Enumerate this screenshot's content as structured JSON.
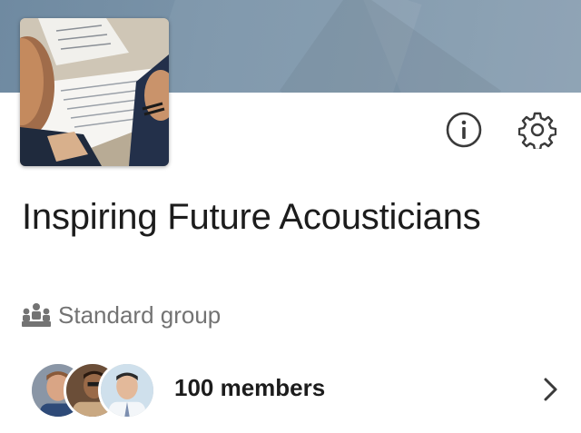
{
  "group": {
    "title": "Inspiring Future Acousticians",
    "type_label": "Standard group",
    "type_icon": "people-group-icon"
  },
  "actions": {
    "info_icon": "info-icon",
    "settings_icon": "gear-icon"
  },
  "members": {
    "label": "100 members",
    "avatars": [
      "member-avatar-1",
      "member-avatar-2",
      "member-avatar-3"
    ],
    "chevron_icon": "chevron-right-icon"
  },
  "colors": {
    "cover": "#7a93a8",
    "title_text": "#1c1c1c",
    "secondary_text": "#737373",
    "icon_stroke": "#3a3a3a"
  }
}
